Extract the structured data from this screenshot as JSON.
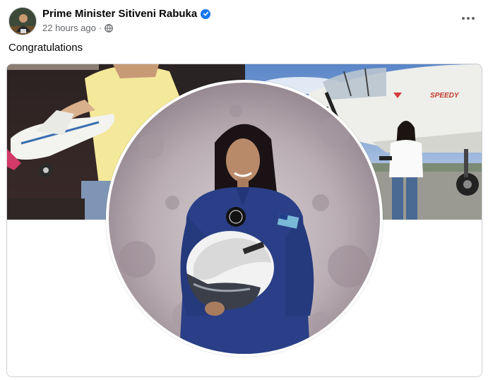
{
  "post": {
    "author_name": "Prime Minister Sitiveni Rabuka",
    "verified": true,
    "timestamp": "22 hours ago",
    "separator": "·",
    "audience_icon": "globe-icon",
    "caption": "Congratulations"
  },
  "icons": {
    "verified": "verified-badge-icon",
    "more": "more-options-icon"
  },
  "colors": {
    "accent": "#1877f2",
    "text_primary": "#050505",
    "text_secondary": "#65676b",
    "flight_suit": "#2a3f87"
  },
  "images": {
    "cover_left": "Childhood photo of a girl in a yellow dress with a toy airplane",
    "cover_right": "Woman in white shirt standing beside a vintage airplane",
    "profile": "Woman in blue flight suit holding a helmet in front of the moon"
  },
  "airplane_marking": "SPEEDY"
}
